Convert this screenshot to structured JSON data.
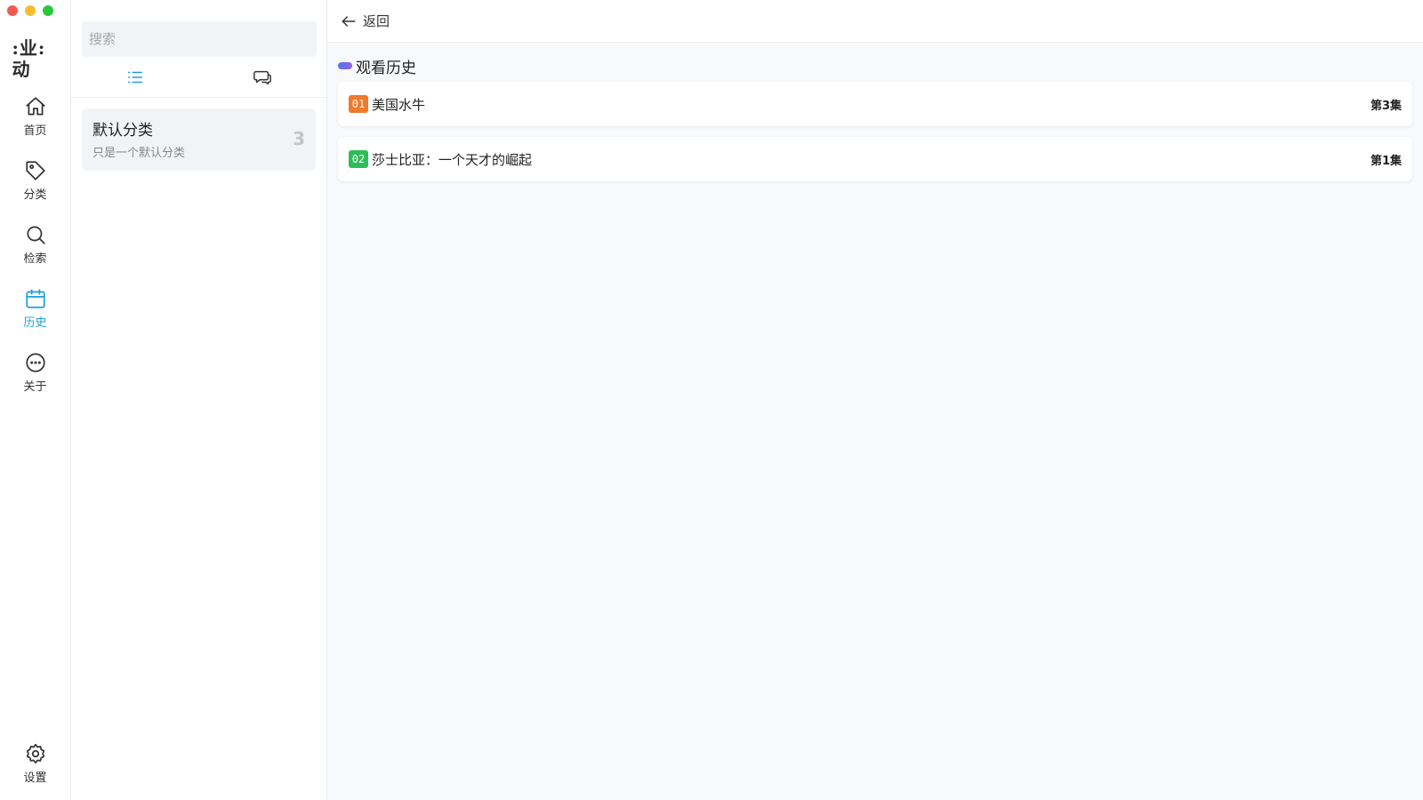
{
  "nav": {
    "logo_text": ":业:动",
    "items": [
      {
        "label": "首页",
        "icon": "home-icon"
      },
      {
        "label": "分类",
        "icon": "tag-icon"
      },
      {
        "label": "检索",
        "icon": "search-icon"
      },
      {
        "label": "历史",
        "icon": "calendar-icon",
        "active": true
      },
      {
        "label": "关于",
        "icon": "more-icon"
      }
    ],
    "settings_label": "设置"
  },
  "sidebar": {
    "search_placeholder": "搜索",
    "tabs": [
      {
        "icon": "list-icon",
        "active": true
      },
      {
        "icon": "chat-icon",
        "active": false
      }
    ],
    "category": {
      "name": "默认分类",
      "description": "只是一个默认分类",
      "count": "3"
    }
  },
  "main": {
    "back_label": "返回",
    "section_title": "观看历史",
    "history": [
      {
        "index": "01",
        "title": "美国水牛",
        "episode": "第3集",
        "badge_color": "#f07a2a"
      },
      {
        "index": "02",
        "title": "莎士比亚：一个天才的崛起",
        "episode": "第1集",
        "badge_color": "#2fbd5a"
      }
    ]
  },
  "colors": {
    "accent": "#1aa0dc"
  }
}
